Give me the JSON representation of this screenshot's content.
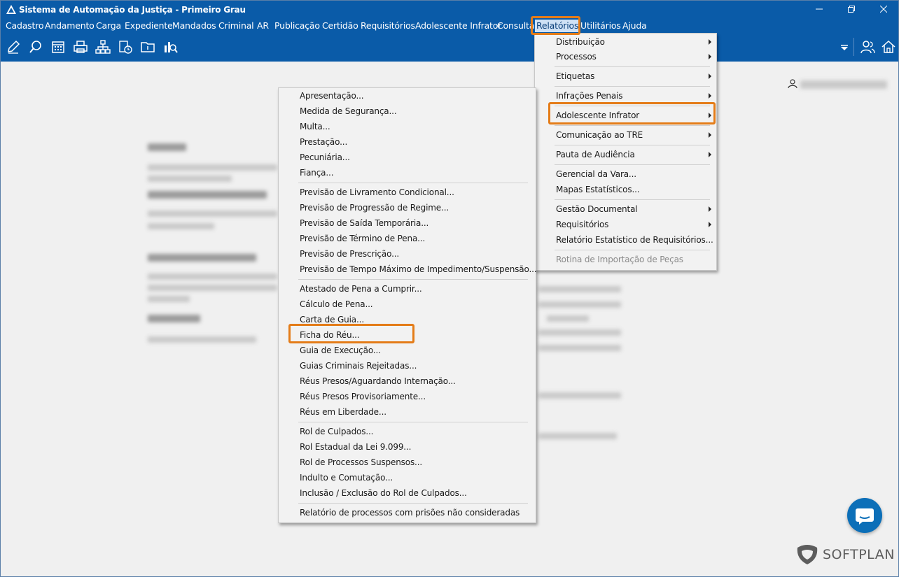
{
  "window": {
    "title": "Sistema de Automação da Justiça - Primeiro Grau",
    "controls": [
      "minimize",
      "restore",
      "close"
    ]
  },
  "menubar": {
    "items": [
      "Cadastro",
      "Andamento",
      "Carga",
      "Expediente",
      "Mandados",
      "Criminal",
      "AR",
      "Publicação",
      "Certidão",
      "Requisitórios",
      "Adolescente Infrator",
      "Consulta",
      "Relatórios",
      "Utilitários",
      "Ajuda"
    ],
    "active": "Relatórios"
  },
  "toolbar": {
    "icons": [
      "edit-icon",
      "search-doc-icon",
      "calendar-icon",
      "printer-icon",
      "hierarchy-icon",
      "queue-icon",
      "folder-icon",
      "statistics-icon"
    ],
    "right_icons": [
      "dropdown-arrow-icon",
      "users-icon",
      "home-icon"
    ]
  },
  "relatorios_menu": {
    "items": [
      {
        "label": "Distribuição",
        "submenu": true
      },
      {
        "label": "Processos",
        "submenu": true
      },
      {
        "label": "Etiquetas",
        "submenu": true
      },
      {
        "label": "Infrações Penais",
        "submenu": true
      },
      {
        "label": "Adolescente Infrator",
        "submenu": true,
        "highlighted": true
      },
      {
        "label": "Comunicação ao TRE",
        "submenu": true
      },
      {
        "label": "Pauta de Audiência",
        "submenu": true
      },
      {
        "label": "Gerencial da Vara...",
        "submenu": false
      },
      {
        "label": "Mapas Estatísticos...",
        "submenu": false
      },
      {
        "label": "Gestão Documental",
        "submenu": true
      },
      {
        "label": "Requisitórios",
        "submenu": true
      },
      {
        "label": "Relatório Estatístico de Requisitórios...",
        "submenu": false
      },
      {
        "label": "Rotina de Importação de Peças",
        "submenu": false,
        "disabled": true
      }
    ]
  },
  "adolescente_submenu": {
    "items": [
      "Apresentação...",
      "Medida de Segurança...",
      "Multa...",
      "Prestação...",
      "Pecuniária...",
      "Fiança...",
      "Previsão de Livramento Condicional...",
      "Previsão de Progressão de Regime...",
      "Previsão de Saída Temporária...",
      "Previsão de Término de Pena...",
      "Previsão de Prescrição...",
      "Previsão de Tempo Máximo de Impedimento/Suspensão...",
      "Atestado de Pena a Cumprir...",
      "Cálculo de Pena...",
      "Carta de Guia...",
      "Ficha do Réu...",
      "Guia de Execução...",
      "Guias Criminais Rejeitadas...",
      "Réus Presos/Aguardando Internação...",
      "Réus Presos Provisoriamente...",
      "Réus em Liberdade...",
      "Rol de Culpados...",
      "Rol Estadual da Lei 9.099...",
      "Rol de Processos Suspensos...",
      "Indulto e Comutação...",
      "Inclusão / Exclusão do Rol de Culpados...",
      "Relatório de processos com prisões não consideradas"
    ],
    "highlighted": "Ficha do Réu..."
  },
  "branding": {
    "logo_text": "SOFTPLAN"
  },
  "colors": {
    "titlebar": "#0a5ba8",
    "highlight": "#e47c18",
    "menu_bg": "#f2f2f2"
  }
}
